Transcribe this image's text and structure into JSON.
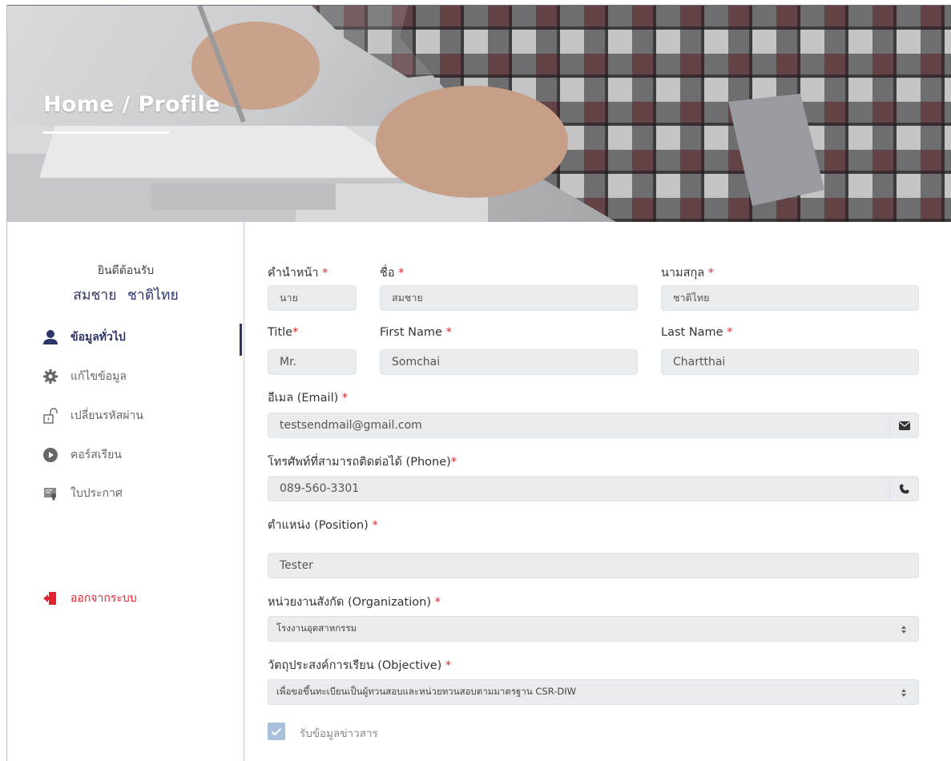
{
  "hero": {
    "title": "Home / Profile"
  },
  "sidebar": {
    "welcome": "ยินดีต้อนรับ",
    "first_name": "สมชาย",
    "last_name": "ชาติไทย",
    "items": [
      {
        "label": "ข้อมูลทั่วไป",
        "icon": "user-icon",
        "active": true
      },
      {
        "label": "แก้ไขข้อมูล",
        "icon": "gear-icon",
        "active": false
      },
      {
        "label": "เปลี่ยนรหัสผ่าน",
        "icon": "unlock-icon",
        "active": false
      },
      {
        "label": "คอร์สเรียน",
        "icon": "play-circle-icon",
        "active": false
      },
      {
        "label": "ใบประกาศ",
        "icon": "certificate-icon",
        "active": false
      }
    ],
    "logout": {
      "label": "ออกจากระบบ",
      "icon": "sign-out-icon"
    }
  },
  "form": {
    "prefix_th": {
      "label": "คำนำหน้า",
      "required": "*",
      "value": "นาย"
    },
    "firstname_th": {
      "label": "ชื่อ",
      "required": "*",
      "value": "สมชาย"
    },
    "lastname_th": {
      "label": "นามสกุล",
      "required": "*",
      "value": "ชาติไทย"
    },
    "title_en": {
      "label": "Title",
      "required": "*",
      "value": "Mr."
    },
    "firstname_en": {
      "label": "First Name",
      "required": "*",
      "value": "Somchai"
    },
    "lastname_en": {
      "label": "Last Name",
      "required": "*",
      "value": "Chartthai"
    },
    "email": {
      "label": "อีเมล (Email)",
      "required": "*",
      "value": "testsendmail@gmail.com",
      "icon": "envelope-icon"
    },
    "phone": {
      "label": "โทรศัพท์ที่สามารถติดต่อได้ (Phone)",
      "required": "*",
      "value": "089-560-3301",
      "icon": "phone-icon"
    },
    "position": {
      "label": "ตำแหน่ง (Position)",
      "required": "*",
      "value": "Tester"
    },
    "organization": {
      "label": "หน่วยงานสังกัด (Organization)",
      "required": "*",
      "value": "โรงงานอุตสาหกรรม"
    },
    "objective": {
      "label": "วัตถุประสงค์การเรียน (Objective)",
      "required": "*",
      "value": "เพื่อขอขึ้นทะเบียนเป็นผู้ทวนสอบและหน่วยทวนสอบตามมาตรฐาน CSR-DIW"
    },
    "newsletter": {
      "label": "รับข้อมูลข่าวสาร",
      "checked": true
    }
  },
  "colors": {
    "brand": "#2c3468",
    "required": "#e0252f",
    "logout": "#e0252f",
    "field_bg": "#e9ecef",
    "checkbox": "#a9c0dd"
  }
}
